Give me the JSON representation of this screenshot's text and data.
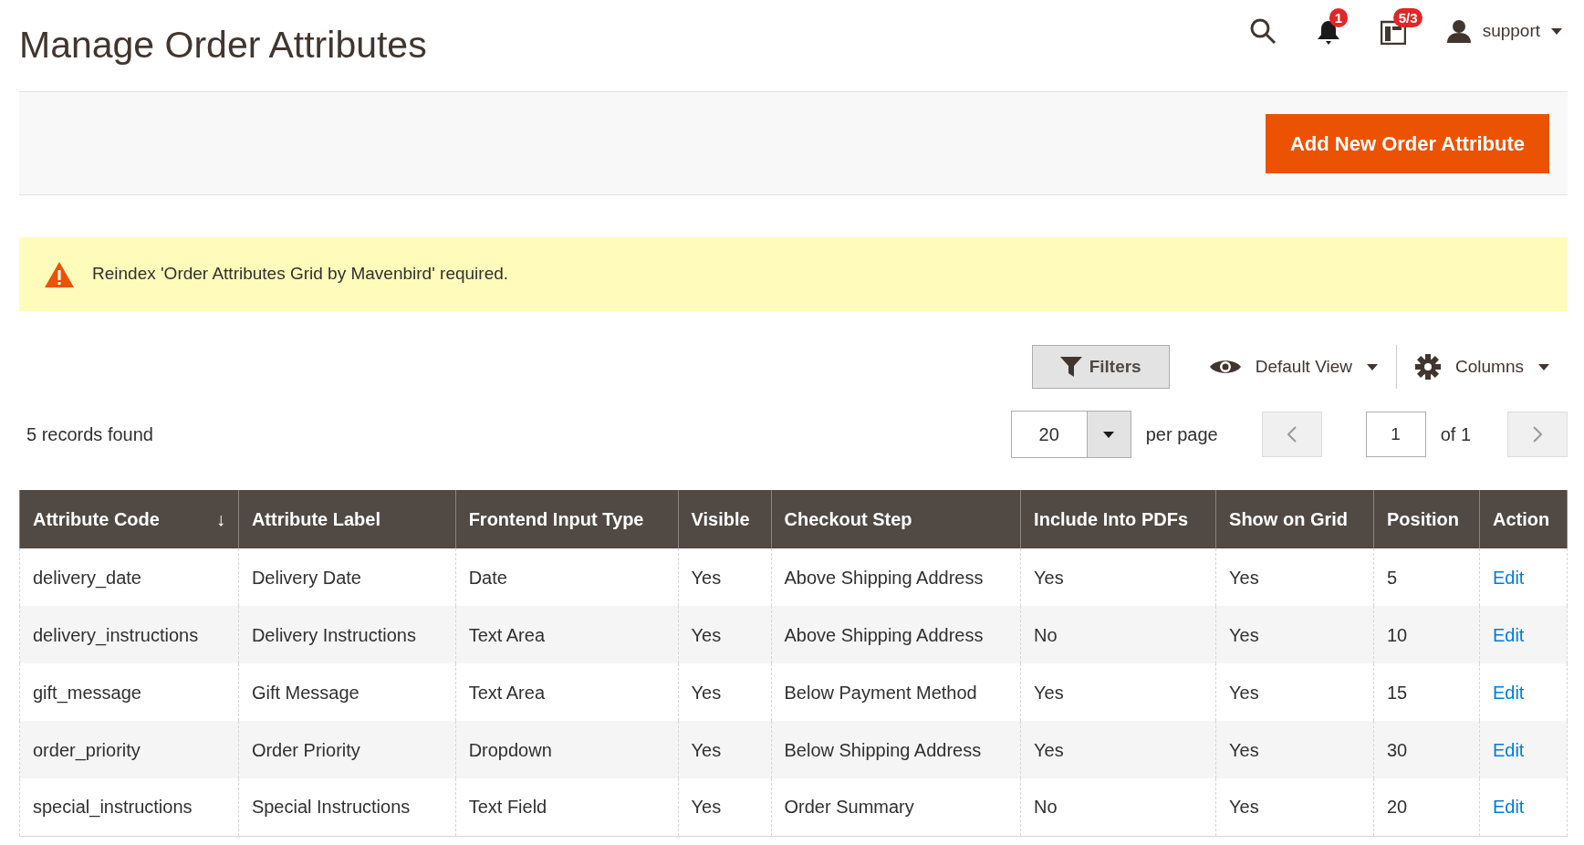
{
  "page_title": "Manage Order Attributes",
  "header": {
    "notifications_count": "1",
    "system_messages_count": "5/3",
    "user": "support"
  },
  "action_bar": {
    "primary_button": "Add New Order Attribute"
  },
  "message": {
    "kind": "warning",
    "text": "Reindex 'Order Attributes Grid by Mavenbird' required."
  },
  "toolbar": {
    "filters_button": "Filters",
    "view": "Default View",
    "columns": "Columns"
  },
  "records_found": "5 records found",
  "pagination": {
    "per_page": "20",
    "per_page_label": "per page",
    "page": "1",
    "of_pages": "of 1"
  },
  "table": {
    "columns": [
      {
        "label": "Attribute Code",
        "sort_indicator": "↓"
      },
      {
        "label": "Attribute Label"
      },
      {
        "label": "Frontend Input Type"
      },
      {
        "label": "Visible"
      },
      {
        "label": "Checkout Step"
      },
      {
        "label": "Include Into PDFs"
      },
      {
        "label": "Show on Grid"
      },
      {
        "label": "Position"
      },
      {
        "label": "Action"
      }
    ],
    "rows": [
      {
        "cells": [
          "delivery_date",
          "Delivery Date",
          "Date",
          "Yes",
          "Above Shipping Address",
          "Yes",
          "Yes",
          "5"
        ],
        "action": "Edit"
      },
      {
        "cells": [
          "delivery_instructions",
          "Delivery Instructions",
          "Text Area",
          "Yes",
          "Above Shipping Address",
          "No",
          "Yes",
          "10"
        ],
        "action": "Edit"
      },
      {
        "cells": [
          "gift_message",
          "Gift Message",
          "Text Area",
          "Yes",
          "Below Payment Method",
          "Yes",
          "Yes",
          "15"
        ],
        "action": "Edit"
      },
      {
        "cells": [
          "order_priority",
          "Order Priority",
          "Dropdown",
          "Yes",
          "Below Shipping Address",
          "Yes",
          "Yes",
          "30"
        ],
        "action": "Edit"
      },
      {
        "cells": [
          "special_instructions",
          "Special Instructions",
          "Text Field",
          "Yes",
          "Order Summary",
          "No",
          "Yes",
          "20"
        ],
        "action": "Edit"
      }
    ]
  }
}
